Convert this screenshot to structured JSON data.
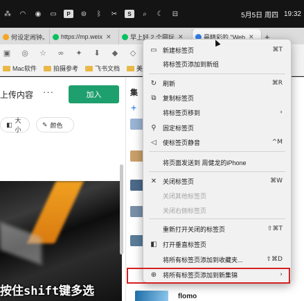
{
  "menubar": {
    "icons": [
      "signal-icon",
      "wifi-icon",
      "wechat-icon",
      "battery-icon",
      "p-icon",
      "e-icon",
      "bluetooth-icon",
      "scissors-icon",
      "s-icon",
      "search-icon",
      "moon-icon",
      "control-center-icon"
    ],
    "badge_p": "P",
    "badge_s": "S",
    "date": "5月5日 周四",
    "time": "19:32"
  },
  "tabs": [
    {
      "label": "何设定闹钟。",
      "color": "#f5a623"
    },
    {
      "label": "https://mp.weix",
      "color": "#07c160"
    },
    {
      "label": "早上好 2 个圆玩",
      "color": "#07c160"
    },
    {
      "label": "最精彩的 \"Web",
      "color": "#2f80ed"
    }
  ],
  "new_tab_symbol": "+",
  "bookmarks": [
    {
      "label": "Mac软件"
    },
    {
      "label": "拍摄参考"
    },
    {
      "label": "飞书文档"
    },
    {
      "label": "美"
    }
  ],
  "page": {
    "upload_title": "上传内容",
    "more": "···",
    "join": "加入",
    "chip_size": "大小",
    "chip_color": "颜色",
    "panel_title": "集",
    "panel_plus": "+",
    "caption": "按住shift键多选",
    "flomo": "flomo"
  },
  "menu": {
    "items": [
      {
        "label": "新建标签页",
        "shortcut": "⌘T",
        "icon": "new-tab-icon",
        "glyph": "▭",
        "disabled": false
      },
      {
        "label": "将标签页添加到新组",
        "shortcut": "",
        "icon": "",
        "glyph": "",
        "disabled": false
      },
      {
        "label": "刷新",
        "shortcut": "⌘R",
        "icon": "refresh-icon",
        "glyph": "↻",
        "disabled": false
      },
      {
        "label": "复制标签页",
        "shortcut": "",
        "icon": "duplicate-icon",
        "glyph": "⧉",
        "disabled": false
      },
      {
        "label": "将标签页移到",
        "shortcut": "›",
        "icon": "",
        "glyph": "",
        "disabled": false
      },
      {
        "label": "固定标签页",
        "shortcut": "",
        "icon": "pin-icon",
        "glyph": "⚲",
        "disabled": false
      },
      {
        "label": "使标签页静音",
        "shortcut": "^M",
        "icon": "mute-icon",
        "glyph": "◁",
        "disabled": false
      },
      {
        "label": "将页面发送到 周健龙的iPhone",
        "shortcut": "",
        "icon": "",
        "glyph": "",
        "disabled": false
      },
      {
        "label": "关闭标签页",
        "shortcut": "⌘W",
        "icon": "close-icon",
        "glyph": "✕",
        "disabled": false
      },
      {
        "label": "关闭其他标签页",
        "shortcut": "",
        "icon": "",
        "glyph": "",
        "disabled": true
      },
      {
        "label": "关闭右侧标签页",
        "shortcut": "",
        "icon": "",
        "glyph": "",
        "disabled": true
      },
      {
        "label": "重新打开关闭的标签页",
        "shortcut": "⇧⌘T",
        "icon": "",
        "glyph": "",
        "disabled": false
      },
      {
        "label": "打开垂直标签页",
        "shortcut": "",
        "icon": "vertical-tabs-icon",
        "glyph": "◧",
        "disabled": false
      },
      {
        "label": "将所有标签页添加到收藏夹...",
        "shortcut": "⇧⌘D",
        "icon": "",
        "glyph": "",
        "disabled": false
      },
      {
        "label": "将所有标签页添加到新集锦",
        "shortcut": "›",
        "icon": "collections-icon",
        "glyph": "⊕",
        "disabled": false
      }
    ]
  },
  "colors": {
    "accent_green": "#1e9f6e",
    "highlight_red": "#d62020"
  }
}
